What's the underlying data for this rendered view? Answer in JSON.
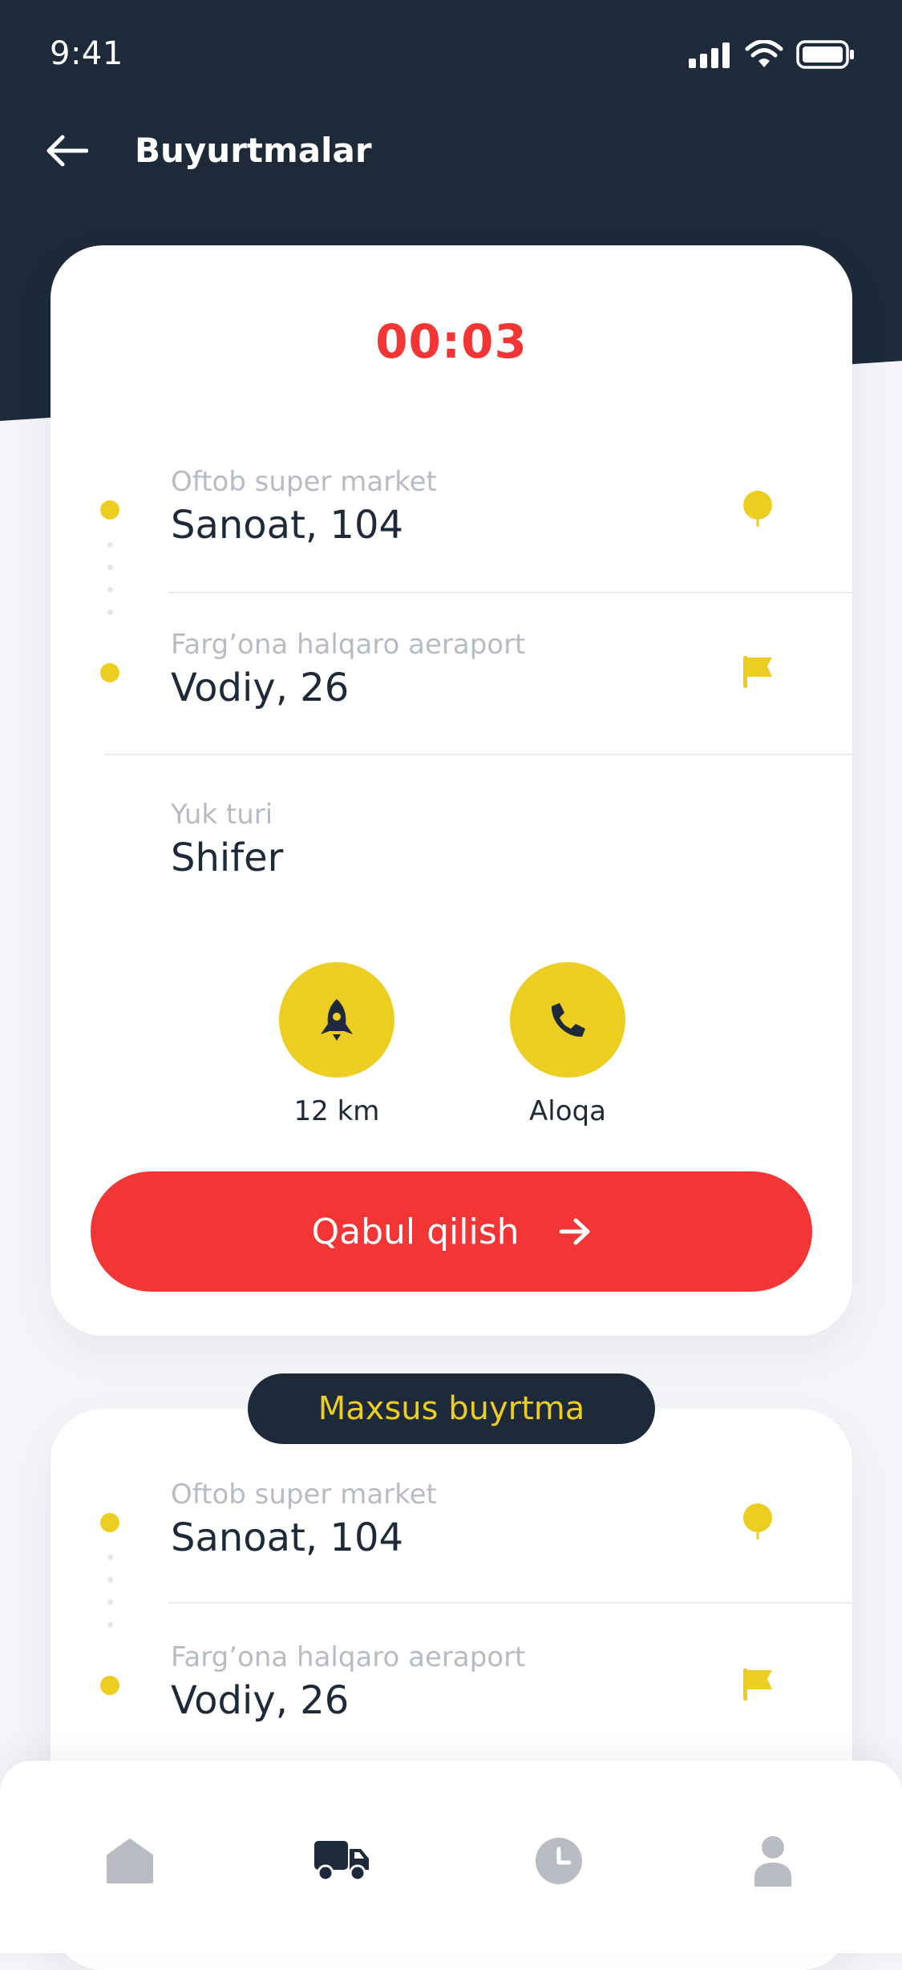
{
  "status_bar": {
    "time": "9:41"
  },
  "header": {
    "title": "Buyurtmalar"
  },
  "order": {
    "timer": "00:03",
    "pickup": {
      "place": "Oftob super market",
      "address": "Sanoat, 104"
    },
    "dropoff": {
      "place": "Farg’ona halqaro aeraport",
      "address": "Vodiy, 26"
    },
    "cargo": {
      "label": "Yuk turi",
      "value": "Shifer"
    },
    "actions": {
      "distance": "12 km",
      "contact": "Aloqa"
    },
    "accept_label": "Qabul qilish"
  },
  "special_order": {
    "badge": "Maxsus buyrtma",
    "pickup": {
      "place": "Oftob super market",
      "address": "Sanoat, 104"
    },
    "dropoff": {
      "place": "Farg’ona halqaro aeraport",
      "address": "Vodiy, 26"
    }
  },
  "tabbar": {
    "items": [
      "home-icon",
      "truck-icon",
      "clock-icon",
      "profile-icon"
    ],
    "active": "truck-icon"
  },
  "colors": {
    "dark": "#1e2a39",
    "accent": "#ecce22",
    "danger": "#f23636",
    "muted": "#b7bcc4",
    "inactive": "#b9bcc2"
  }
}
